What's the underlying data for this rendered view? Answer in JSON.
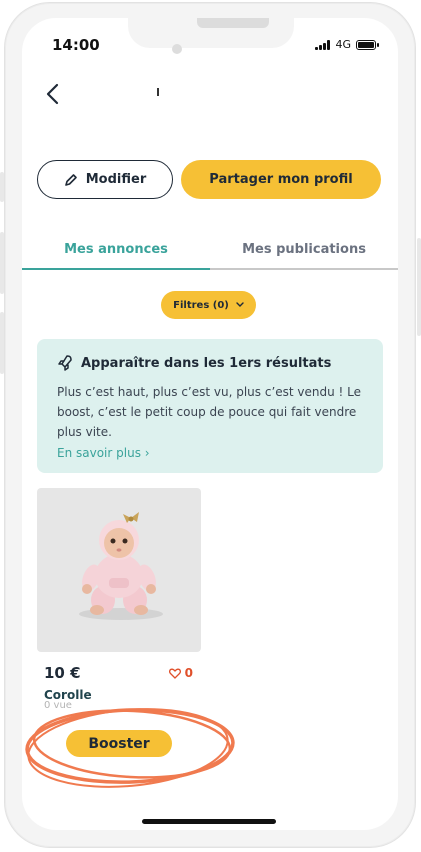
{
  "status": {
    "time": "14:00",
    "network": "4G"
  },
  "actions": {
    "edit_label": "Modifier",
    "share_label": "Partager mon profil"
  },
  "tabs": [
    {
      "label": "Mes annonces",
      "active": true
    },
    {
      "label": "Mes publications",
      "active": false
    }
  ],
  "filter": {
    "label": "Filtres (0)"
  },
  "promo": {
    "title": "Apparaître dans les 1ers résultats",
    "text": "Plus c’est haut, plus c’est vu, plus c’est vendu ! Le boost, c’est le petit coup de pouce qui fait vendre plus vite.",
    "link": "En savoir plus ›"
  },
  "listing": {
    "price": "10 €",
    "likes": "0",
    "brand": "Corolle",
    "sub": "0 vue"
  },
  "booster": {
    "label": "Booster"
  },
  "colors": {
    "accent": "#f6c035",
    "teal": "#3aa39b",
    "promo_bg": "#ddf1ee",
    "highlight": "#f07a4f"
  }
}
